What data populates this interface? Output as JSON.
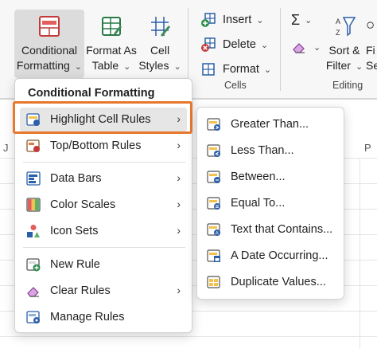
{
  "ribbon": {
    "conditional_formatting": {
      "line1": "Conditional",
      "line2": "Formatting"
    },
    "format_as_table": {
      "line1": "Format As",
      "line2": "Table"
    },
    "cell_styles": {
      "line1": "Cell",
      "line2": "Styles"
    },
    "cells_group": {
      "insert": "Insert",
      "delete": "Delete",
      "format": "Format",
      "label": "Cells"
    },
    "editing_group": {
      "sigma": "Σ",
      "sort_filter": {
        "line1": "Sort &",
        "line2": "Filter"
      },
      "find_partial": {
        "line1": "Fi",
        "line2": "Se"
      },
      "label": "Editing"
    },
    "chevron": "⌄"
  },
  "sheet": {
    "col_headers": [
      "J",
      "P"
    ]
  },
  "menu": {
    "title": "Conditional Formatting",
    "items": [
      {
        "label": "Highlight Cell Rules",
        "icon": "highlight-cells-icon",
        "has_submenu": true
      },
      {
        "label": "Top/Bottom Rules",
        "icon": "top-bottom-icon",
        "has_submenu": true
      },
      {
        "label": "Data Bars",
        "icon": "data-bars-icon",
        "has_submenu": true
      },
      {
        "label": "Color Scales",
        "icon": "color-scales-icon",
        "has_submenu": true
      },
      {
        "label": "Icon Sets",
        "icon": "icon-sets-icon",
        "has_submenu": true
      },
      {
        "label": "New Rule",
        "icon": "new-rule-icon",
        "has_submenu": false
      },
      {
        "label": "Clear Rules",
        "icon": "clear-rules-icon",
        "has_submenu": true
      },
      {
        "label": "Manage Rules",
        "icon": "manage-rules-icon",
        "has_submenu": false
      }
    ],
    "arrow": "›"
  },
  "submenu": {
    "items": [
      {
        "label": "Greater Than...",
        "icon": "greater-than-icon"
      },
      {
        "label": "Less Than...",
        "icon": "less-than-icon"
      },
      {
        "label": "Between...",
        "icon": "between-icon"
      },
      {
        "label": "Equal To...",
        "icon": "equal-to-icon"
      },
      {
        "label": "Text that Contains...",
        "icon": "text-contains-icon"
      },
      {
        "label": "A Date Occurring...",
        "icon": "date-occurring-icon"
      },
      {
        "label": "Duplicate Values...",
        "icon": "duplicate-values-icon"
      }
    ]
  },
  "colors": {
    "accent_orange": "#e8772e",
    "ribbon_bg": "#f7f7f7",
    "highlight_bg": "#e6e6e6"
  }
}
